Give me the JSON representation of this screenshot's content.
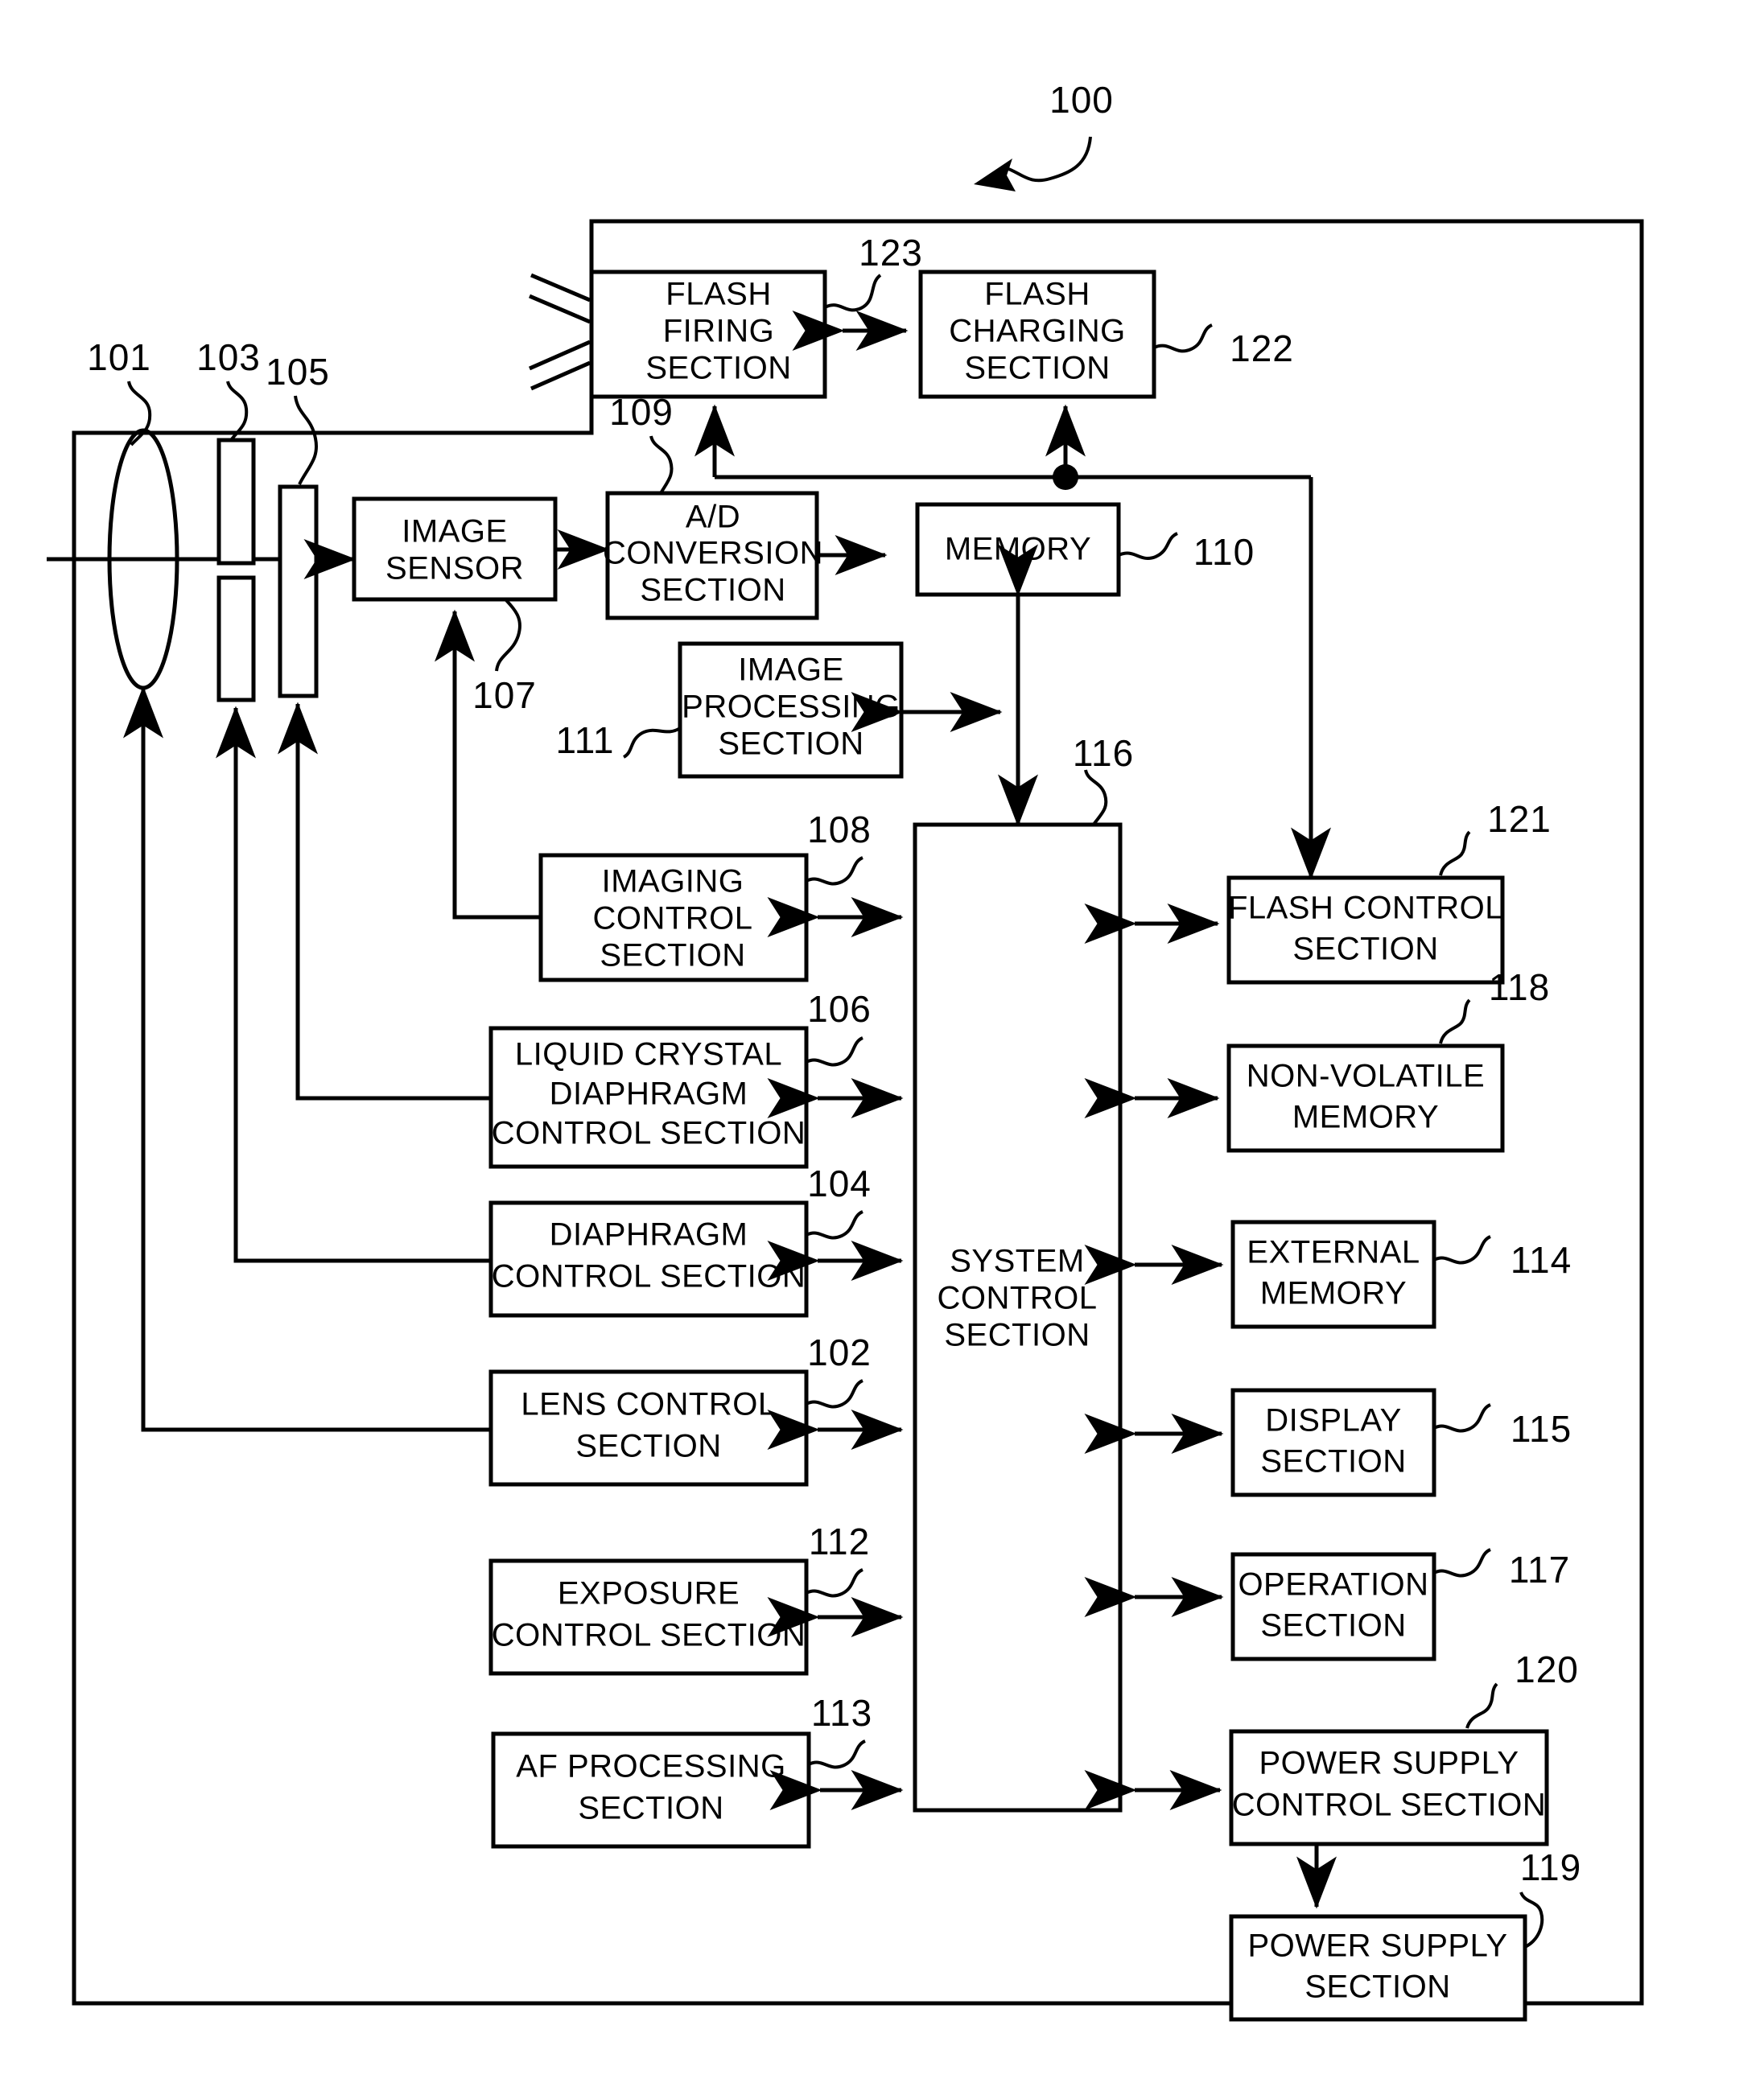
{
  "figure": {
    "kind": "patent-block-diagram",
    "subject": "Imaging apparatus block diagram",
    "system_reference": "100",
    "background_color": "#ffffff",
    "line_color": "#000000"
  },
  "optics": [
    {
      "ref": "101",
      "name": "lens",
      "shape": "ellipse"
    },
    {
      "ref": "103",
      "name": "diaphragm",
      "shape": "two-blades"
    },
    {
      "ref": "105",
      "name": "liquid-crystal-diaphragm",
      "shape": "bar"
    }
  ],
  "blocks": [
    {
      "id": "flash_firing",
      "ref": "123",
      "lines": [
        "FLASH",
        "FIRING",
        "SECTION"
      ]
    },
    {
      "id": "flash_charging",
      "ref": "122",
      "lines": [
        "FLASH",
        "CHARGING",
        "SECTION"
      ]
    },
    {
      "id": "image_sensor",
      "ref": "107",
      "lines": [
        "IMAGE",
        "SENSOR"
      ]
    },
    {
      "id": "ad_conversion",
      "ref": "109",
      "lines": [
        "A/D",
        "CONVERSION",
        "SECTION"
      ]
    },
    {
      "id": "memory",
      "ref": "110",
      "lines": [
        "MEMORY"
      ]
    },
    {
      "id": "image_processing",
      "ref": "111",
      "lines": [
        "IMAGE",
        "PROCESSING",
        "SECTION"
      ]
    },
    {
      "id": "system_control",
      "ref": "116",
      "lines": [
        "SYSTEM",
        "CONTROL",
        "SECTION"
      ]
    },
    {
      "id": "imaging_control",
      "ref": "108",
      "lines": [
        "IMAGING",
        "CONTROL",
        "SECTION"
      ]
    },
    {
      "id": "lcd_diaphragm_control",
      "ref": "106",
      "lines": [
        "LIQUID CRYSTAL",
        "DIAPHRAGM",
        "CONTROL SECTION"
      ]
    },
    {
      "id": "diaphragm_control",
      "ref": "104",
      "lines": [
        "DIAPHRAGM",
        "CONTROL SECTION"
      ]
    },
    {
      "id": "lens_control",
      "ref": "102",
      "lines": [
        "LENS CONTROL",
        "SECTION"
      ]
    },
    {
      "id": "exposure_control",
      "ref": "112",
      "lines": [
        "EXPOSURE",
        "CONTROL SECTION"
      ]
    },
    {
      "id": "af_processing",
      "ref": "113",
      "lines": [
        "AF PROCESSING",
        "SECTION"
      ]
    },
    {
      "id": "flash_control",
      "ref": "121",
      "lines": [
        "FLASH CONTROL",
        "SECTION"
      ]
    },
    {
      "id": "nonvolatile_memory",
      "ref": "118",
      "lines": [
        "NON-VOLATILE",
        "MEMORY"
      ]
    },
    {
      "id": "external_memory",
      "ref": "114",
      "lines": [
        "EXTERNAL",
        "MEMORY"
      ]
    },
    {
      "id": "display",
      "ref": "115",
      "lines": [
        "DISPLAY",
        "SECTION"
      ]
    },
    {
      "id": "operation",
      "ref": "117",
      "lines": [
        "OPERATION",
        "SECTION"
      ]
    },
    {
      "id": "power_supply_control",
      "ref": "120",
      "lines": [
        "POWER SUPPLY",
        "CONTROL SECTION"
      ]
    },
    {
      "id": "power_supply",
      "ref": "119",
      "lines": [
        "POWER SUPPLY",
        "SECTION"
      ]
    }
  ],
  "text": {
    "flash_firing_1": "FLASH",
    "flash_firing_2": "FIRING",
    "flash_firing_3": "SECTION",
    "flash_charging_1": "FLASH",
    "flash_charging_2": "CHARGING",
    "flash_charging_3": "SECTION",
    "image_sensor_1": "IMAGE",
    "image_sensor_2": "SENSOR",
    "ad_1": "A/D",
    "ad_2": "CONVERSION",
    "ad_3": "SECTION",
    "memory_1": "MEMORY",
    "imgproc_1": "IMAGE",
    "imgproc_2": "PROCESSING",
    "imgproc_3": "SECTION",
    "syscon_1": "SYSTEM",
    "syscon_2": "CONTROL",
    "syscon_3": "SECTION",
    "imgctl_1": "IMAGING",
    "imgctl_2": "CONTROL",
    "imgctl_3": "SECTION",
    "lcd_1": "LIQUID CRYSTAL",
    "lcd_2": "DIAPHRAGM",
    "lcd_3": "CONTROL SECTION",
    "diaph_1": "DIAPHRAGM",
    "diaph_2": "CONTROL SECTION",
    "lensctl_1": "LENS CONTROL",
    "lensctl_2": "SECTION",
    "expo_1": "EXPOSURE",
    "expo_2": "CONTROL SECTION",
    "af_1": "AF PROCESSING",
    "af_2": "SECTION",
    "flashctl_1": "FLASH CONTROL",
    "flashctl_2": "SECTION",
    "nvm_1": "NON-VOLATILE",
    "nvm_2": "MEMORY",
    "extmem_1": "EXTERNAL",
    "extmem_2": "MEMORY",
    "disp_1": "DISPLAY",
    "disp_2": "SECTION",
    "oper_1": "OPERATION",
    "oper_2": "SECTION",
    "pwrctl_1": "POWER SUPPLY",
    "pwrctl_2": "CONTROL SECTION",
    "pwr_1": "POWER SUPPLY",
    "pwr_2": "SECTION"
  },
  "refs": {
    "r100": "100",
    "r101": "101",
    "r102": "102",
    "r103": "103",
    "r104": "104",
    "r105": "105",
    "r106": "106",
    "r107": "107",
    "r108": "108",
    "r109": "109",
    "r110": "110",
    "r111": "111",
    "r112": "112",
    "r113": "113",
    "r114": "114",
    "r115": "115",
    "r116": "116",
    "r117": "117",
    "r118": "118",
    "r119": "119",
    "r120": "120",
    "r121": "121",
    "r122": "122",
    "r123": "123"
  }
}
